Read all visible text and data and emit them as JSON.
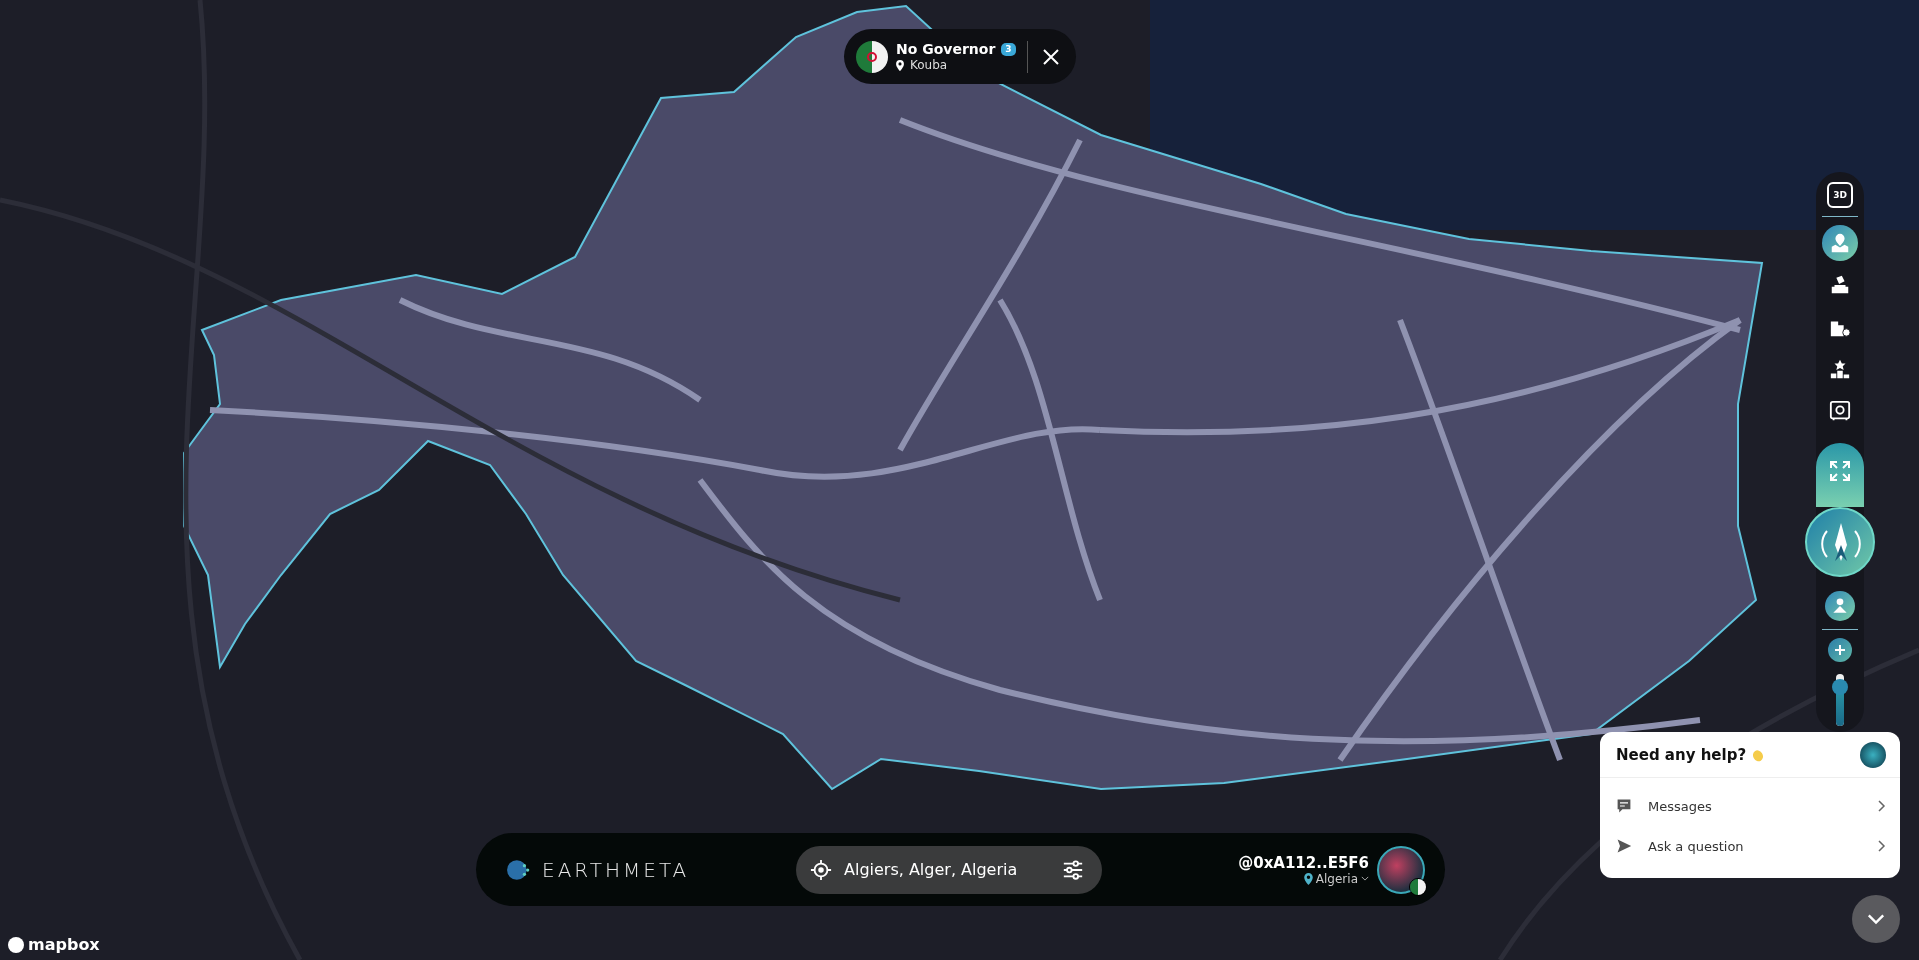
{
  "header": {
    "title": "No Governor",
    "badge": "3",
    "location": "Kouba"
  },
  "toolbar": {
    "view_mode": "3D",
    "tools": [
      {
        "kind": "map-user",
        "selected": true
      },
      {
        "kind": "ballot",
        "selected": false
      },
      {
        "kind": "buildings",
        "selected": false
      },
      {
        "kind": "podium",
        "selected": false
      },
      {
        "kind": "safe",
        "selected": false
      }
    ],
    "zoom": {
      "level": 0.75
    }
  },
  "bottom_bar": {
    "brand": "EARTHMETA",
    "search": {
      "value": "Algiers, Alger, Algeria"
    },
    "user": {
      "handle": "@0xA112..E5F6",
      "country": "Algeria"
    }
  },
  "help": {
    "title": "Need any help?",
    "items": [
      {
        "kind": "messages",
        "label": "Messages"
      },
      {
        "kind": "ask",
        "label": "Ask a question"
      }
    ]
  },
  "attribution": {
    "logo": "mapbox"
  }
}
